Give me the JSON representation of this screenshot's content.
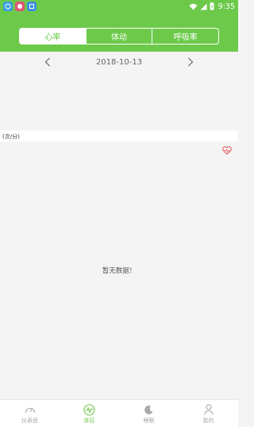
{
  "status_bar": {
    "time": "9:35"
  },
  "header": {
    "tabs": [
      {
        "label": "心率"
      },
      {
        "label": "体动"
      },
      {
        "label": "呼吸率"
      }
    ],
    "active_tab_index": 0
  },
  "date_nav": {
    "date": "2018-10-13"
  },
  "chart": {
    "unit_label": "(次/分)",
    "empty_message": "暂无数据！"
  },
  "bottom_nav": {
    "items": [
      {
        "label": "仪表盘",
        "icon": "gauge-icon"
      },
      {
        "label": "体征",
        "icon": "vital-signs-icon"
      },
      {
        "label": "睡眠",
        "icon": "moon-icon"
      },
      {
        "label": "我的",
        "icon": "person-icon"
      }
    ],
    "active_index": 1
  },
  "colors": {
    "accent": "#6cc94a",
    "background": "#f4f4f4",
    "heart": "#e05555"
  }
}
